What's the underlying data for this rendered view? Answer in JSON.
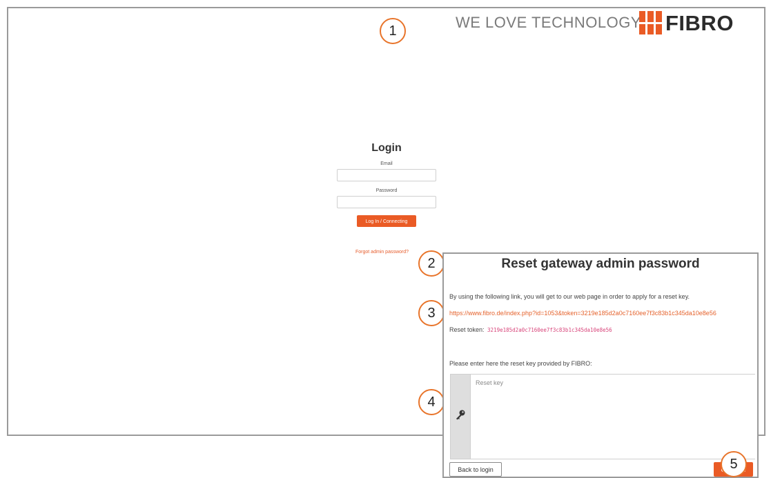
{
  "header": {
    "tagline": "WE LOVE TECHNOLOGY",
    "logo_text": "FIBRO",
    "brand_color": "#ea5b25"
  },
  "callouts": [
    "1",
    "2",
    "3",
    "4",
    "5"
  ],
  "login": {
    "title": "Login",
    "email_label": "Email",
    "email_value": "",
    "password_label": "Password",
    "password_value": "",
    "button_label": "Log In / Connecting",
    "forgot_link": "Forgot admin password?"
  },
  "reset_dialog": {
    "title": "Reset gateway admin password",
    "intro": "By using the following link, you will get to our web page in order to apply for a reset key.",
    "link": "https://www.fibro.de/index.php?id=1053&token=3219e185d2a0c7160ee7f3c83b1c345da10e8e56",
    "token_label": "Reset token:",
    "token_value": "3219e185d2a0c7160ee7f3c83b1c345da10e8e56",
    "enter_prompt": "Please enter here the reset key provided by FIBRO:",
    "reset_key_placeholder": "Reset key",
    "reset_key_value": "",
    "key_icon": "key-icon",
    "back_button": "Back to login",
    "continue_button": "Continue"
  }
}
